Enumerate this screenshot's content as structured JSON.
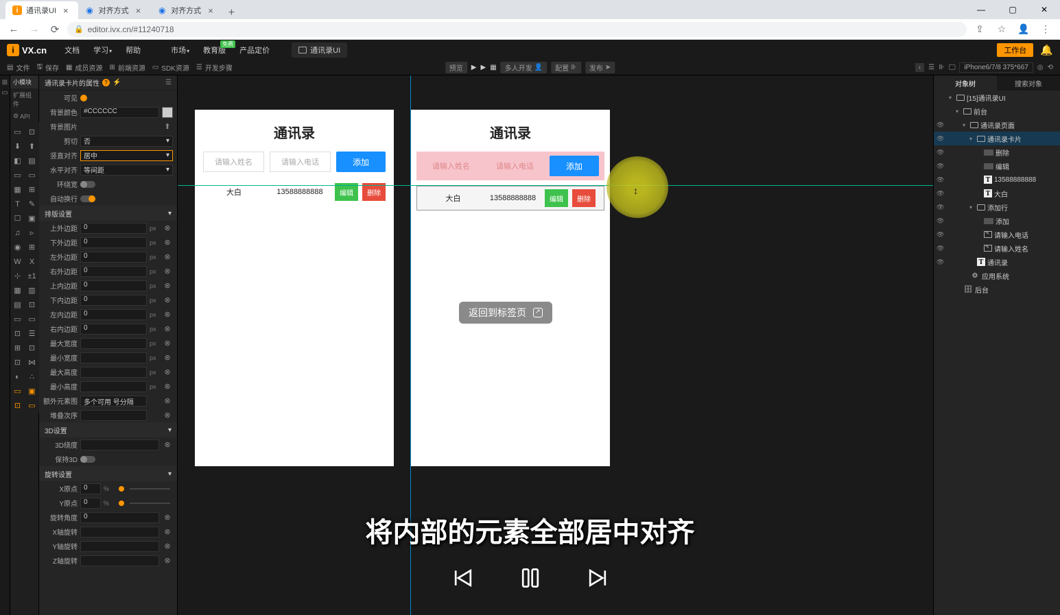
{
  "browser": {
    "tabs": [
      {
        "icon": "orange",
        "label": "通讯录UI",
        "active": true
      },
      {
        "icon": "c",
        "label": "对齐方式",
        "active": false
      },
      {
        "icon": "c",
        "label": "对齐方式",
        "active": false
      }
    ],
    "url": "editor.ivx.cn/#11240718"
  },
  "header": {
    "brand": "VX.cn",
    "menu": [
      "文档",
      "学习",
      "帮助",
      "市场",
      "教育版",
      "产品定价"
    ],
    "edu_badge": "免费",
    "project_tab": "通讯录UI",
    "workbench": "工作台"
  },
  "subbar": {
    "left": [
      {
        "icon": "▤",
        "label": "文件"
      },
      {
        "icon": "🖫",
        "label": "保存"
      },
      {
        "icon": "▦",
        "label": "成员资源"
      },
      {
        "icon": "⊞",
        "label": "前端资源"
      },
      {
        "icon": "▭",
        "label": "SDK资源"
      },
      {
        "icon": "☰",
        "label": "开发步骤"
      }
    ],
    "center": {
      "preview": "预览",
      "multi": "多人开发",
      "config": "配置",
      "publish": "发布"
    },
    "device": "iPhone6/7/8 375*667"
  },
  "left_categories": [
    "小模块",
    "扩展组件",
    "API"
  ],
  "props_panel": {
    "title": "通讯录卡片的属性",
    "rows": [
      {
        "label": "背景颜色",
        "type": "color",
        "value": "#CCCCCC"
      },
      {
        "label": "背景图片",
        "type": "upload",
        "value": ""
      },
      {
        "label": "剪切",
        "type": "select",
        "value": "否"
      },
      {
        "label": "竖直对齐",
        "type": "select",
        "value": "居中",
        "hl": true
      },
      {
        "label": "水平对齐",
        "type": "select",
        "value": "等间距"
      },
      {
        "label": "环绕宽",
        "type": "switch",
        "on": false
      },
      {
        "label": "自动换行",
        "type": "switch",
        "on": true
      }
    ],
    "section_layout": "排版设置",
    "layout_rows": [
      {
        "label": "上外边距",
        "value": "0",
        "unit": "px"
      },
      {
        "label": "下外边距",
        "value": "0",
        "unit": "px"
      },
      {
        "label": "左外边距",
        "value": "0",
        "unit": "px"
      },
      {
        "label": "右外边距",
        "value": "0",
        "unit": "px"
      },
      {
        "label": "上内边距",
        "value": "0",
        "unit": "px"
      },
      {
        "label": "下内边距",
        "value": "0",
        "unit": "px"
      },
      {
        "label": "左内边距",
        "value": "0",
        "unit": "px"
      },
      {
        "label": "右内边距",
        "value": "0",
        "unit": "px"
      },
      {
        "label": "最大宽度",
        "value": "",
        "unit": "px"
      },
      {
        "label": "最小宽度",
        "value": "",
        "unit": "px"
      },
      {
        "label": "最大高度",
        "value": "",
        "unit": "px"
      },
      {
        "label": "最小高度",
        "value": "",
        "unit": "px"
      },
      {
        "label": "额外元素图",
        "value": "多个可用 号分隔",
        "unit": ""
      },
      {
        "label": "堆叠次序",
        "value": "",
        "unit": ""
      }
    ],
    "section_3d": "3D设置",
    "rows_3d": [
      {
        "label": "3D绕度",
        "value": ""
      },
      {
        "label": "保持3D",
        "type": "switch"
      }
    ],
    "section_rotate": "旋转设置",
    "rotate_rows": [
      {
        "label": "X原点",
        "value": "0",
        "unit": "%"
      },
      {
        "label": "Y原点",
        "value": "0",
        "unit": "%"
      },
      {
        "label": "旋转角度",
        "value": "0",
        "unit": ""
      },
      {
        "label": "X轴旋转",
        "value": "",
        "unit": ""
      },
      {
        "label": "Y轴旋转",
        "value": "",
        "unit": ""
      },
      {
        "label": "Z轴旋转",
        "value": "",
        "unit": ""
      }
    ]
  },
  "phone": {
    "title": "通讯录",
    "input_name": "请输入姓名",
    "input_phone": "请输入电话",
    "add": "添加",
    "row": {
      "name": "大白",
      "phone": "13588888888",
      "edit": "编辑",
      "delete": "删除"
    }
  },
  "return_pill": "返回到标签页",
  "tree": {
    "tabs": [
      "对象树",
      "搜索对象"
    ],
    "nodes": [
      {
        "depth": 0,
        "icon": "box",
        "label": "[15]通讯录UI",
        "exp": "▾"
      },
      {
        "depth": 1,
        "icon": "box",
        "label": "前台",
        "exp": "▾"
      },
      {
        "depth": 2,
        "icon": "box",
        "label": "通讯录页面",
        "exp": "▾",
        "eye": true
      },
      {
        "depth": 3,
        "icon": "box",
        "label": "通讯录卡片",
        "exp": "▾",
        "eye": true,
        "sel": true
      },
      {
        "depth": 4,
        "icon": "btn",
        "label": "删除",
        "eye": true
      },
      {
        "depth": 4,
        "icon": "btn",
        "label": "编辑",
        "eye": true
      },
      {
        "depth": 4,
        "icon": "t",
        "label": "13588888888",
        "eye": true
      },
      {
        "depth": 4,
        "icon": "t",
        "label": "大白",
        "eye": true
      },
      {
        "depth": 3,
        "icon": "box",
        "label": "添加行",
        "exp": "▾",
        "eye": true
      },
      {
        "depth": 4,
        "icon": "btn",
        "label": "添加",
        "eye": true
      },
      {
        "depth": 4,
        "icon": "inp",
        "label": "请输入电话",
        "eye": true
      },
      {
        "depth": 4,
        "icon": "inp",
        "label": "请输入姓名",
        "eye": true
      },
      {
        "depth": 3,
        "icon": "t",
        "label": "通讯录",
        "eye": true
      },
      {
        "depth": 2,
        "icon": "gear",
        "label": "应用系统"
      },
      {
        "depth": 1,
        "icon": "db",
        "label": "后台"
      }
    ]
  },
  "subtitle": "将内部的元素全部居中对齐"
}
